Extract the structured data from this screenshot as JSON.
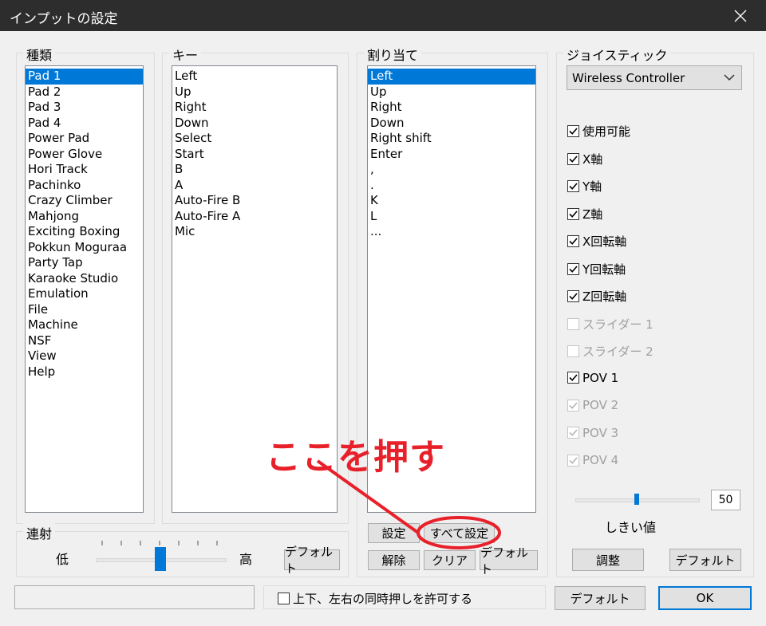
{
  "window": {
    "title": "インプットの設定"
  },
  "type_group": {
    "label": "種類",
    "items": [
      "Pad 1",
      "Pad 2",
      "Pad 3",
      "Pad 4",
      "Power Pad",
      "Power Glove",
      "Hori Track",
      "Pachinko",
      "Crazy Climber",
      "Mahjong",
      "Exciting Boxing",
      "Pokkun Moguraa",
      "Party Tap",
      "Karaoke Studio",
      "Emulation",
      "File",
      "Machine",
      "NSF",
      "View",
      "Help"
    ],
    "selected_index": 0
  },
  "key_group": {
    "label": "キー",
    "items": [
      "Left",
      "Up",
      "Right",
      "Down",
      "Select",
      "Start",
      "B",
      "A",
      "Auto-Fire B",
      "Auto-Fire A",
      "Mic"
    ]
  },
  "assign_group": {
    "label": "割り当て",
    "items": [
      "Left",
      "Up",
      "Right",
      "Down",
      "Right shift",
      "Enter",
      ",",
      ".",
      "K",
      "L",
      "..."
    ],
    "selected_index": 0,
    "buttons": {
      "set": "設定",
      "set_all": "すべて設定",
      "release": "解除",
      "clear": "クリア",
      "default": "デフォルト"
    }
  },
  "joystick_group": {
    "label": "ジョイスティック",
    "device": "Wireless Controller",
    "checkboxes": [
      {
        "label": "使用可能",
        "checked": true,
        "enabled": true
      },
      {
        "label": "X軸",
        "checked": true,
        "enabled": true
      },
      {
        "label": "Y軸",
        "checked": true,
        "enabled": true
      },
      {
        "label": "Z軸",
        "checked": true,
        "enabled": true
      },
      {
        "label": "X回転軸",
        "checked": true,
        "enabled": true
      },
      {
        "label": "Y回転軸",
        "checked": true,
        "enabled": true
      },
      {
        "label": "Z回転軸",
        "checked": true,
        "enabled": true
      },
      {
        "label": "スライダー 1",
        "checked": false,
        "enabled": false
      },
      {
        "label": "スライダー 2",
        "checked": false,
        "enabled": false
      },
      {
        "label": "POV 1",
        "checked": true,
        "enabled": true
      },
      {
        "label": "POV 2",
        "checked": true,
        "enabled": false
      },
      {
        "label": "POV 3",
        "checked": true,
        "enabled": false
      },
      {
        "label": "POV 4",
        "checked": true,
        "enabled": false
      }
    ],
    "threshold_value": "50",
    "threshold_fraction": 0.5,
    "threshold_label": "しきい値",
    "buttons": {
      "adjust": "調整",
      "default": "デフォルト"
    }
  },
  "rapid_group": {
    "label": "連射",
    "low": "低",
    "high": "高",
    "slider_fraction": 0.5,
    "default_button": "デフォルト"
  },
  "bottom": {
    "simultaneous_checkbox": "上下、左右の同時押しを許可する",
    "simultaneous_checked": false,
    "default_button": "デフォルト",
    "ok_button": "OK"
  },
  "annotation": {
    "text": "ここを押す",
    "color": "#e8202a"
  },
  "colors": {
    "selection": "#0078d7",
    "titlebar": "#2d2d2d"
  }
}
